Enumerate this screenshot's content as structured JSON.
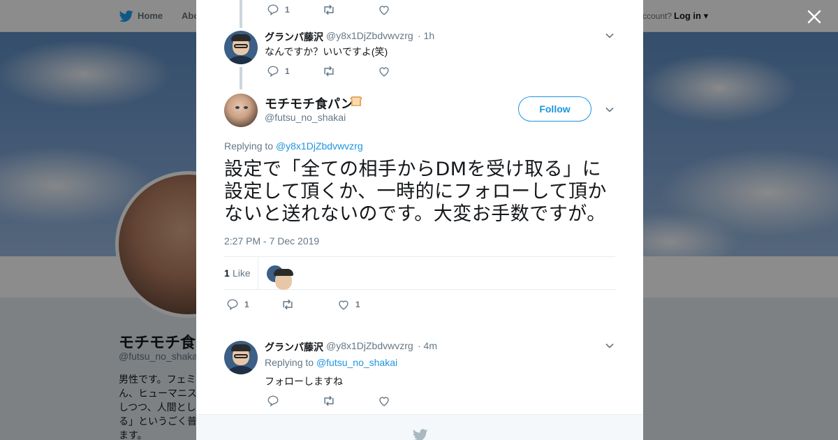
{
  "topbar": {
    "home_label": "Home",
    "about_label": "Abo",
    "account_prompt": "ccount?",
    "login_label": "Log in"
  },
  "profile": {
    "name": "モチモチ食",
    "handle": "@futsu_no_shaka",
    "bio": "男性です。フェミん、ヒューマニスしつつ、人間としる」というごく普ます。"
  },
  "thread": [
    {
      "reply_count": "1"
    },
    {
      "name": "グランパ藤沢",
      "handle": "@y8x1DjZbdvwvzrg",
      "time": "· 1h",
      "text": "なんですか？いいですよ(笑)",
      "reply_count": "1"
    }
  ],
  "main_tweet": {
    "name": "モチモチ食パン",
    "handle": "@futsu_no_shakai",
    "follow_label": "Follow",
    "replying_prefix": "Replying to",
    "replying_to": "@y8x1DjZbdvwvzrg",
    "text": "設定で「全ての相手からDMを受け取る」に設定して頂くか、一時的にフォローして頂かないと送れないのです。大変お手数ですが。",
    "timestamp": "2:27 PM - 7 Dec 2019",
    "like_count": "1",
    "like_label": "Like",
    "reply_count": "1",
    "favorite_count": "1"
  },
  "reply": {
    "name": "グランパ藤沢",
    "handle": "@y8x1DjZbdvwvzrg",
    "time": "· 4m",
    "replying_prefix": "Replying to",
    "replying_to": "@futsu_no_shakai",
    "text": "フォローしますね"
  },
  "colors": {
    "accent": "#1b95e0",
    "text": "#14171a",
    "muted": "#657786",
    "border": "#e6ecf0"
  }
}
